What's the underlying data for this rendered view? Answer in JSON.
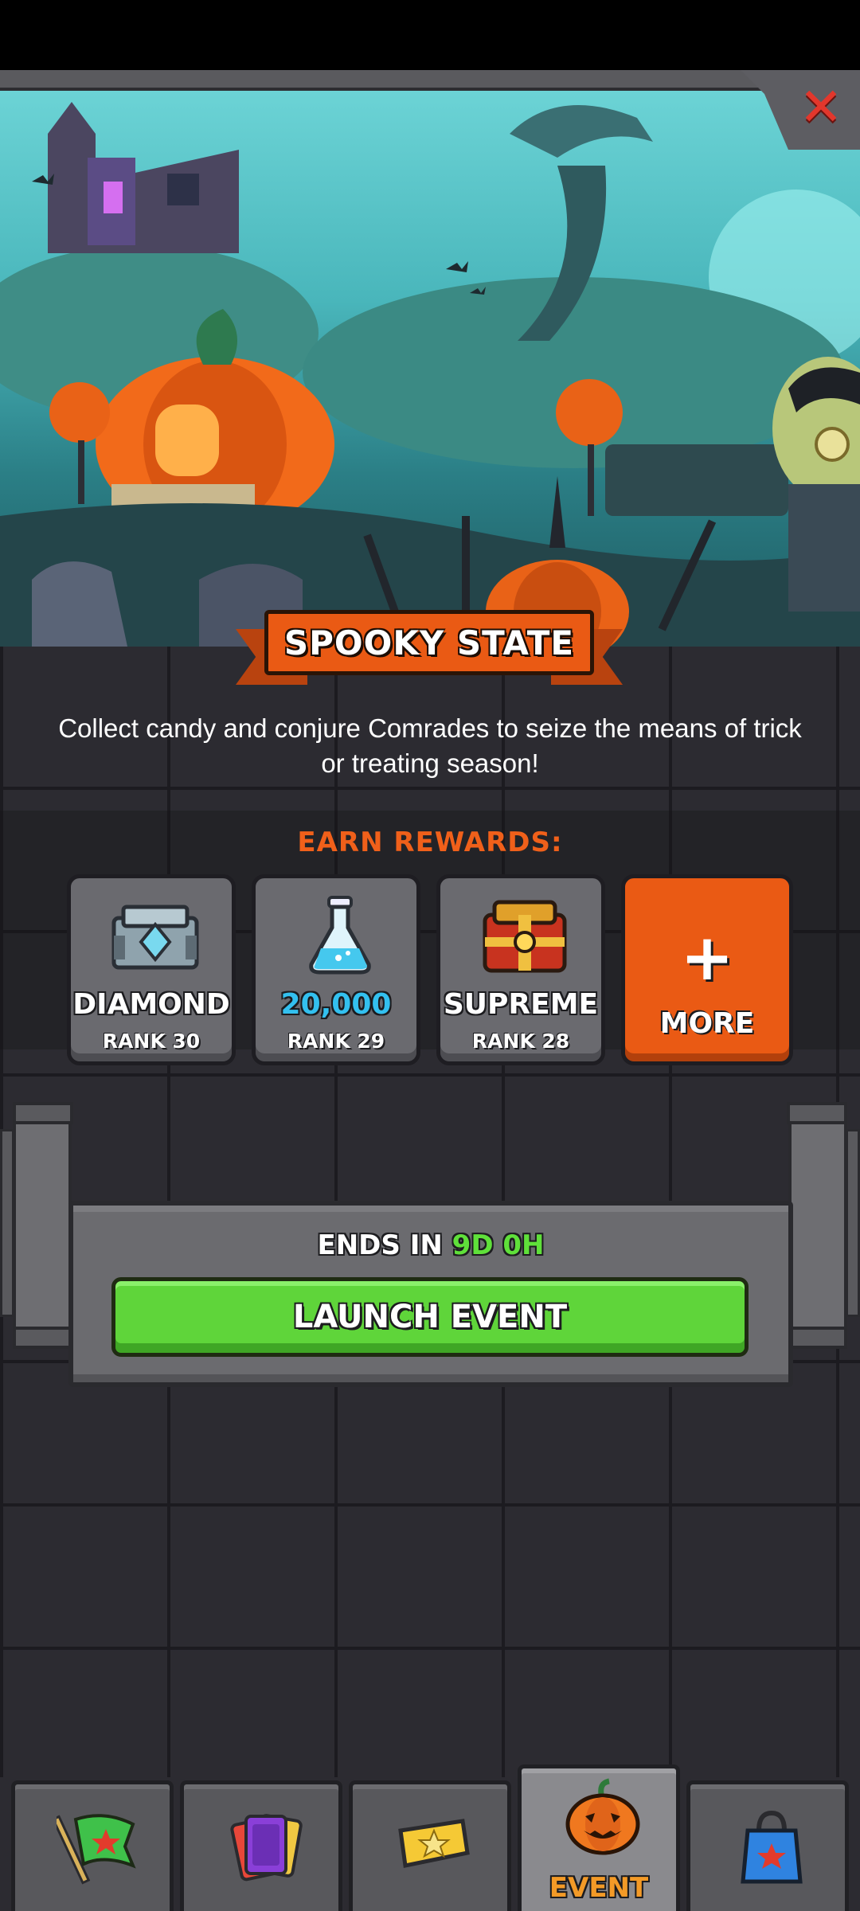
{
  "event": {
    "title": "SPOOKY STATE",
    "description": "Collect candy and conjure Comrades to seize the means of trick or treating season!",
    "close_icon": "close-x-icon"
  },
  "rewards": {
    "heading": "EARN REWARDS:",
    "items": [
      {
        "name": "DIAMOND",
        "rank": "RANK 30",
        "icon": "diamond-crate-icon"
      },
      {
        "name": "20,000",
        "rank": "RANK 29",
        "icon": "potion-flask-icon"
      },
      {
        "name": "SUPREME",
        "rank": "RANK 28",
        "icon": "supreme-crate-icon"
      }
    ],
    "more": {
      "symbol": "+",
      "label": "MORE"
    }
  },
  "timer": {
    "prefix": "ENDS IN",
    "days": "9D",
    "hours": "0H"
  },
  "launch_button": "LAUNCH EVENT",
  "tabs": [
    {
      "icon": "flag-icon",
      "label": ""
    },
    {
      "icon": "cards-icon",
      "label": ""
    },
    {
      "icon": "ticket-star-icon",
      "label": ""
    },
    {
      "icon": "pumpkin-icon",
      "label": "EVENT",
      "active": true
    },
    {
      "icon": "shop-bag-icon",
      "label": ""
    }
  ],
  "colors": {
    "accent_orange": "#ea5a14",
    "button_green": "#5fd53a",
    "timer_green": "#5fe03a",
    "value_blue": "#33c0ef",
    "close_red": "#e2372c"
  }
}
